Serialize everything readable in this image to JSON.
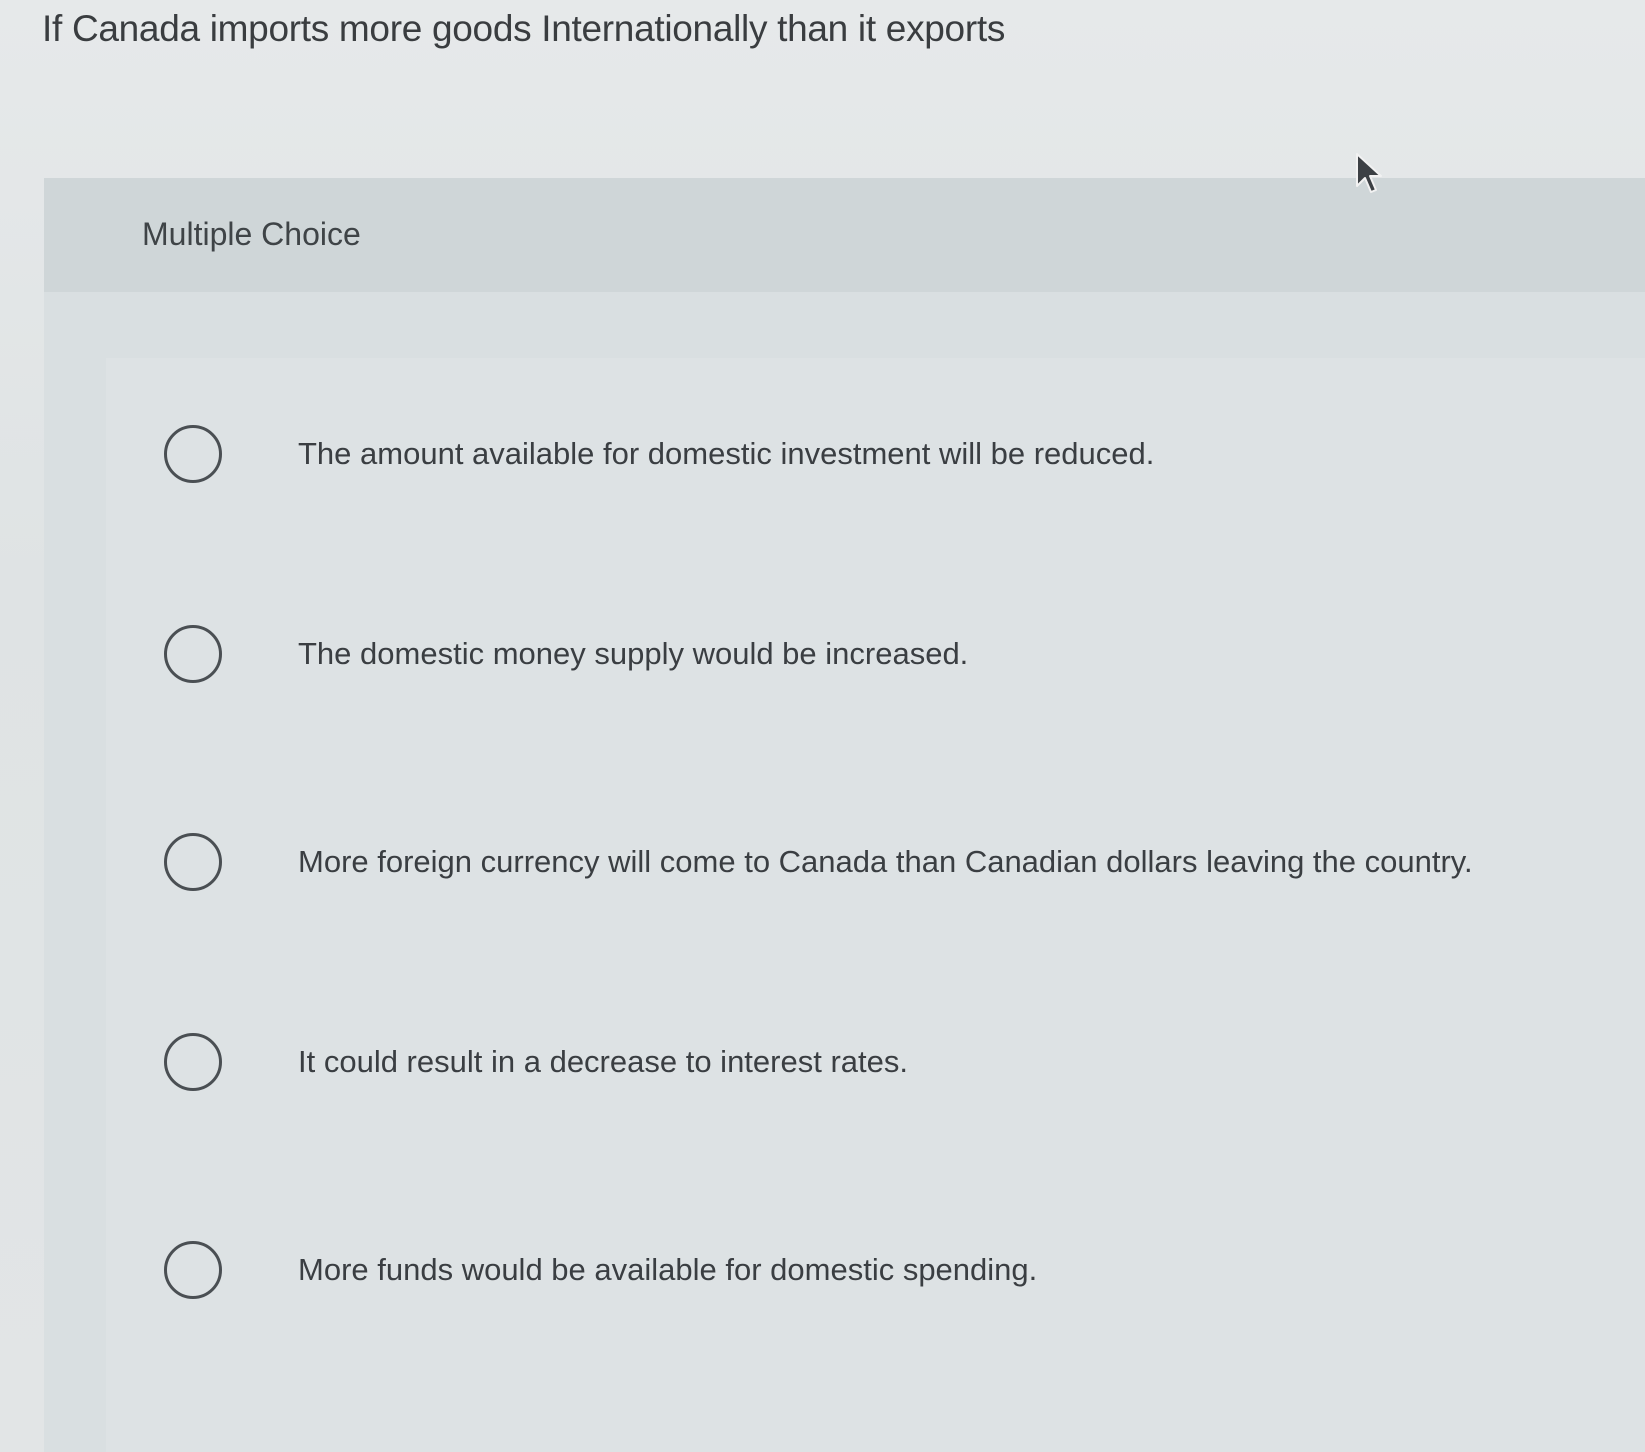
{
  "question": {
    "text": "If Canada imports more goods Internationally than it exports"
  },
  "card": {
    "header_label": "Multiple Choice"
  },
  "options": [
    {
      "text": "The amount available for domestic investment will be reduced."
    },
    {
      "text": "The domestic money supply would be increased."
    },
    {
      "text": "More foreign currency will come to Canada than Canadian dollars leaving the country."
    },
    {
      "text": "It could result in a decrease to interest rates."
    },
    {
      "text": "More funds would be available for domestic spending."
    }
  ],
  "colors": {
    "page_bg": "#e3e6e7",
    "header_bg": "#cfd6d8",
    "option_area_bg": "#dde2e4",
    "text": "#3a3e42"
  },
  "icons": {
    "cursor": "mouse-pointer-icon",
    "radio": "radio-button-empty"
  }
}
